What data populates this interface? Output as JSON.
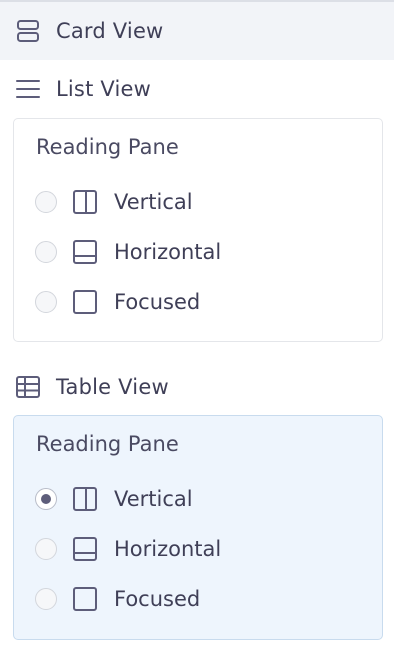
{
  "views": {
    "card": {
      "label": "Card View",
      "icon": "card-view-icon"
    },
    "list": {
      "label": "List View",
      "icon": "list-view-icon"
    },
    "table": {
      "label": "Table View",
      "icon": "table-view-icon"
    }
  },
  "list_pane": {
    "title": "Reading Pane",
    "options": [
      {
        "label": "Vertical",
        "icon": "vertical-pane-icon",
        "checked": false
      },
      {
        "label": "Horizontal",
        "icon": "horizontal-pane-icon",
        "checked": false
      },
      {
        "label": "Focused",
        "icon": "focused-pane-icon",
        "checked": false
      }
    ]
  },
  "table_pane": {
    "title": "Reading Pane",
    "options": [
      {
        "label": "Vertical",
        "icon": "vertical-pane-icon",
        "checked": true
      },
      {
        "label": "Horizontal",
        "icon": "horizontal-pane-icon",
        "checked": false
      },
      {
        "label": "Focused",
        "icon": "focused-pane-icon",
        "checked": false
      }
    ]
  },
  "colors": {
    "selected_bg": "#eef5fd",
    "hover_bg": "#f2f4f8",
    "text": "#3f3f57",
    "radio_dot": "#5d5d7a"
  }
}
